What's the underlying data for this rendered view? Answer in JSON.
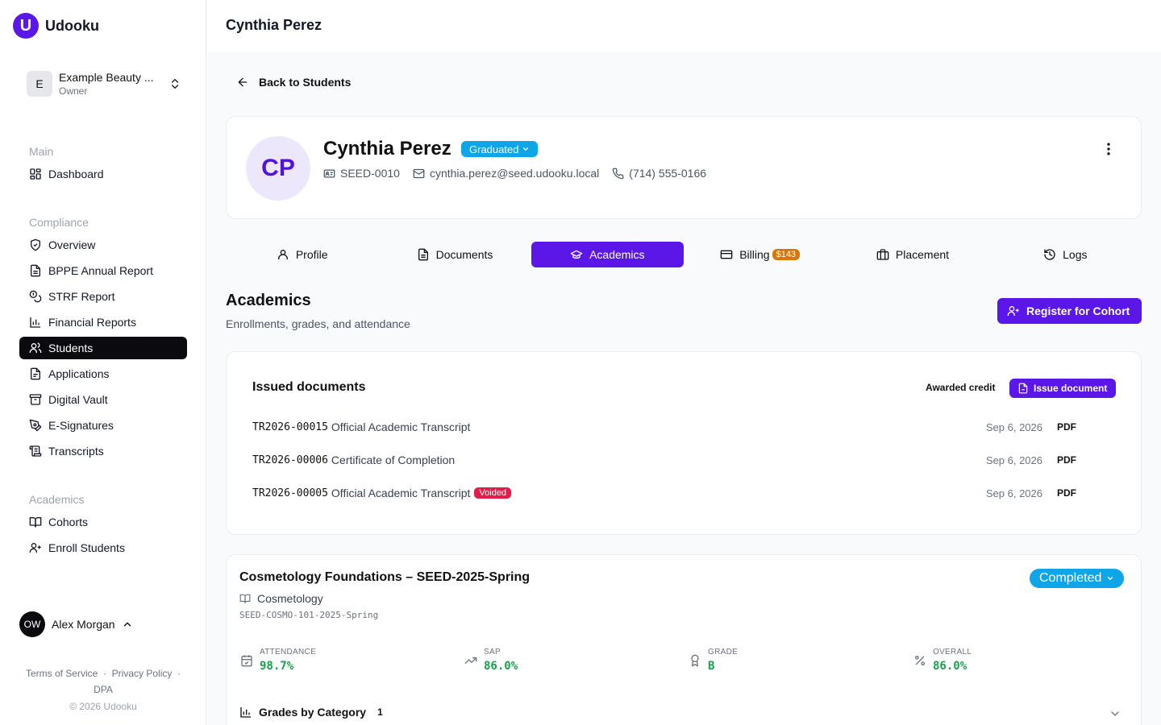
{
  "brand": {
    "logo_letter": "U",
    "name": "Udooku"
  },
  "org": {
    "initial": "E",
    "name": "Example Beauty ...",
    "role": "Owner"
  },
  "nav": {
    "main": {
      "heading": "Main",
      "items": [
        {
          "label": "Dashboard",
          "icon": "dashboard-icon"
        }
      ]
    },
    "compliance": {
      "heading": "Compliance",
      "items": [
        {
          "label": "Overview",
          "icon": "shield-icon"
        },
        {
          "label": "BPPE Annual Report",
          "icon": "file-text-icon"
        },
        {
          "label": "STRF Report",
          "icon": "coins-icon"
        },
        {
          "label": "Financial Reports",
          "icon": "bar-chart-icon"
        },
        {
          "label": "Students",
          "icon": "users-icon",
          "active": true
        },
        {
          "label": "Applications",
          "icon": "file-icon"
        },
        {
          "label": "Digital Vault",
          "icon": "archive-icon"
        },
        {
          "label": "E-Signatures",
          "icon": "signature-icon"
        },
        {
          "label": "Transcripts",
          "icon": "scroll-icon"
        }
      ]
    },
    "academics": {
      "heading": "Academics",
      "items": [
        {
          "label": "Cohorts",
          "icon": "book-icon"
        },
        {
          "label": "Enroll Students",
          "icon": "user-plus-icon"
        }
      ]
    }
  },
  "user": {
    "initials": "OW",
    "name": "Alex Morgan"
  },
  "footer": {
    "terms": "Terms of Service",
    "privacy": "Privacy Policy",
    "dpa": "DPA",
    "copyright": "© 2026 Udooku"
  },
  "header": {
    "title": "Cynthia Perez"
  },
  "back_label": "Back to Students",
  "profile": {
    "initials": "CP",
    "name": "Cynthia Perez",
    "status": "Graduated",
    "student_id": "SEED-0010",
    "email": "cynthia.perez@seed.udooku.local",
    "phone": "(714) 555-0166"
  },
  "tabs": [
    {
      "label": "Profile",
      "icon": "user-icon"
    },
    {
      "label": "Documents",
      "icon": "file-text-icon"
    },
    {
      "label": "Academics",
      "icon": "graduation-cap-icon",
      "active": true
    },
    {
      "label": "Billing",
      "icon": "credit-card-icon",
      "badge": "$143"
    },
    {
      "label": "Placement",
      "icon": "briefcase-icon"
    },
    {
      "label": "Logs",
      "icon": "history-icon"
    }
  ],
  "academics": {
    "title": "Academics",
    "subtitle": "Enrollments, grades, and attendance",
    "register_label": "Register for Cohort"
  },
  "issued_docs": {
    "title": "Issued documents",
    "awarded_label": "Awarded credit",
    "issue_label": "Issue document",
    "rows": [
      {
        "id": "TR2026-00015",
        "name": "Official Academic Transcript",
        "date": "Sep 6, 2026",
        "type": "PDF",
        "badge": ""
      },
      {
        "id": "TR2026-00006",
        "name": "Certificate of Completion",
        "date": "Sep 6, 2026",
        "type": "PDF",
        "badge": ""
      },
      {
        "id": "TR2026-00005",
        "name": "Official Academic Transcript",
        "date": "Sep 6, 2026",
        "type": "PDF",
        "badge": "Voided"
      }
    ]
  },
  "cohort": {
    "title": "Cosmetology Foundations – SEED-2025-Spring",
    "status": "Completed",
    "program": "Cosmetology",
    "code": "SEED-COSMO-101-2025-Spring",
    "stats": [
      {
        "label": "ATTENDANCE",
        "value": "98.7%",
        "icon": "calendar-check-icon"
      },
      {
        "label": "SAP",
        "value": "86.0%",
        "icon": "trending-up-icon"
      },
      {
        "label": "GRADE",
        "value": "B",
        "icon": "award-icon"
      },
      {
        "label": "OVERALL",
        "value": "86.0%",
        "icon": "percent-icon"
      }
    ],
    "grades_label": "Grades by Category",
    "grades_count": "1"
  }
}
